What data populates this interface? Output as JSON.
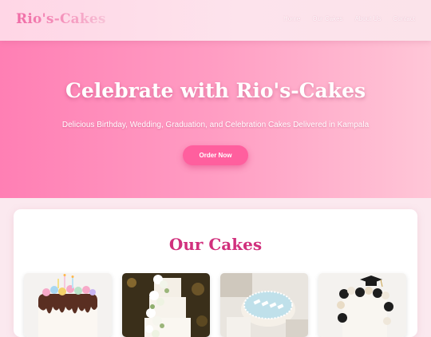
{
  "header": {
    "logo": "Rio's-Cakes",
    "nav": [
      "Home",
      "Our Cakes",
      "About Us",
      "Contact"
    ]
  },
  "hero": {
    "title": "Celebrate with Rio's-Cakes",
    "subtitle": "Delicious Birthday, Wedding, Graduation, and Celebration Cakes Delivered in Kampala",
    "cta": "Order Now"
  },
  "cakes": {
    "title": "Our Cakes",
    "items": [
      {
        "image": "birthday-cake-image"
      },
      {
        "image": "wedding-cake-image"
      },
      {
        "image": "celebration-cake-image"
      },
      {
        "image": "graduation-cake-image"
      }
    ]
  },
  "colors": {
    "accent": "#ff5f9e",
    "heading": "#d1307d",
    "hero_gradient_start": "#ff7fb4",
    "hero_gradient_end": "#ffc6d7"
  }
}
